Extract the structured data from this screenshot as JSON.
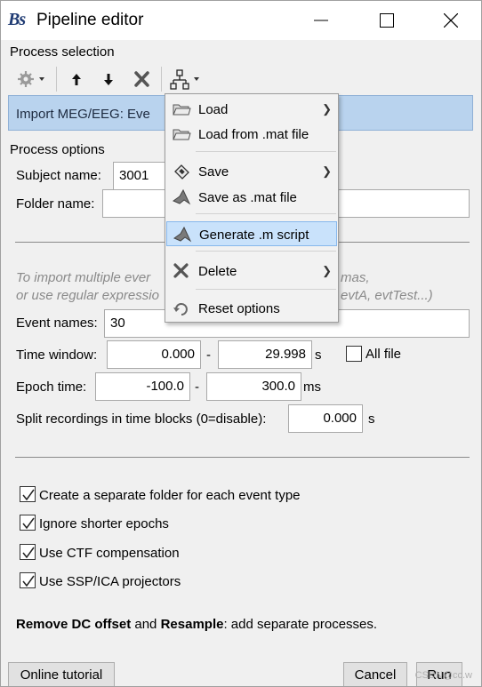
{
  "window": {
    "logo": "Bs",
    "title": "Pipeline editor"
  },
  "process_selection": {
    "label": "Process selection",
    "list_item": "Import MEG/EEG: Eve"
  },
  "process_options": {
    "label": "Process options",
    "subject_name_label": "Subject name:",
    "subject_name_value": "3001",
    "folder_name_label": "Folder name:",
    "folder_name_value": "",
    "hint_line1": "To import multiple ever",
    "hint_line1_end": "mas,",
    "hint_line2": "or use regular expressio",
    "hint_line2_end": "evtA, evtTest...)",
    "event_names_label": "Event names:",
    "event_names_value": "30",
    "time_window_label": "Time window:",
    "time_window_start": "0.000",
    "time_window_dash": "-",
    "time_window_end": "29.998",
    "time_window_unit": "s",
    "all_file_label": "All file",
    "epoch_time_label": "Epoch time:",
    "epoch_start": "-100.0",
    "epoch_dash": "-",
    "epoch_end": "300.0",
    "epoch_unit": "ms",
    "split_label": "Split recordings in time blocks (0=disable):",
    "split_value": "0.000",
    "split_unit": "s"
  },
  "checkboxes": [
    {
      "label": "Create a separate folder for each event type",
      "checked": true
    },
    {
      "label": "Ignore shorter epochs",
      "checked": true
    },
    {
      "label": "Use CTF compensation",
      "checked": true
    },
    {
      "label": "Use SSP/ICA projectors",
      "checked": true
    }
  ],
  "note": {
    "bold1": "Remove DC offset",
    "mid": " and ",
    "bold2": "Resample",
    "rest": ": add separate processes."
  },
  "footer": {
    "tutorial": "Online tutorial",
    "cancel": "Cancel",
    "run": "Run"
  },
  "menu": {
    "items": [
      {
        "label": "Load",
        "icon": "folder-icon",
        "submenu": true
      },
      {
        "label": "Load from .mat file",
        "icon": "folder-icon",
        "submenu": false
      },
      {
        "label": "Save",
        "icon": "save-icon",
        "submenu": true
      },
      {
        "label": "Save as .mat file",
        "icon": "matlab-icon",
        "submenu": false
      },
      {
        "label": "Generate .m script",
        "icon": "matlab-icon",
        "submenu": false,
        "highlighted": true
      },
      {
        "label": "Delete",
        "icon": "delete-icon",
        "submenu": true
      },
      {
        "label": "Reset options",
        "icon": "reset-icon",
        "submenu": false
      }
    ]
  },
  "watermark": "CSDN@cc.w",
  "colors": {
    "selection": "#b9d3ee",
    "menu_highlight": "#c9e2fb"
  }
}
